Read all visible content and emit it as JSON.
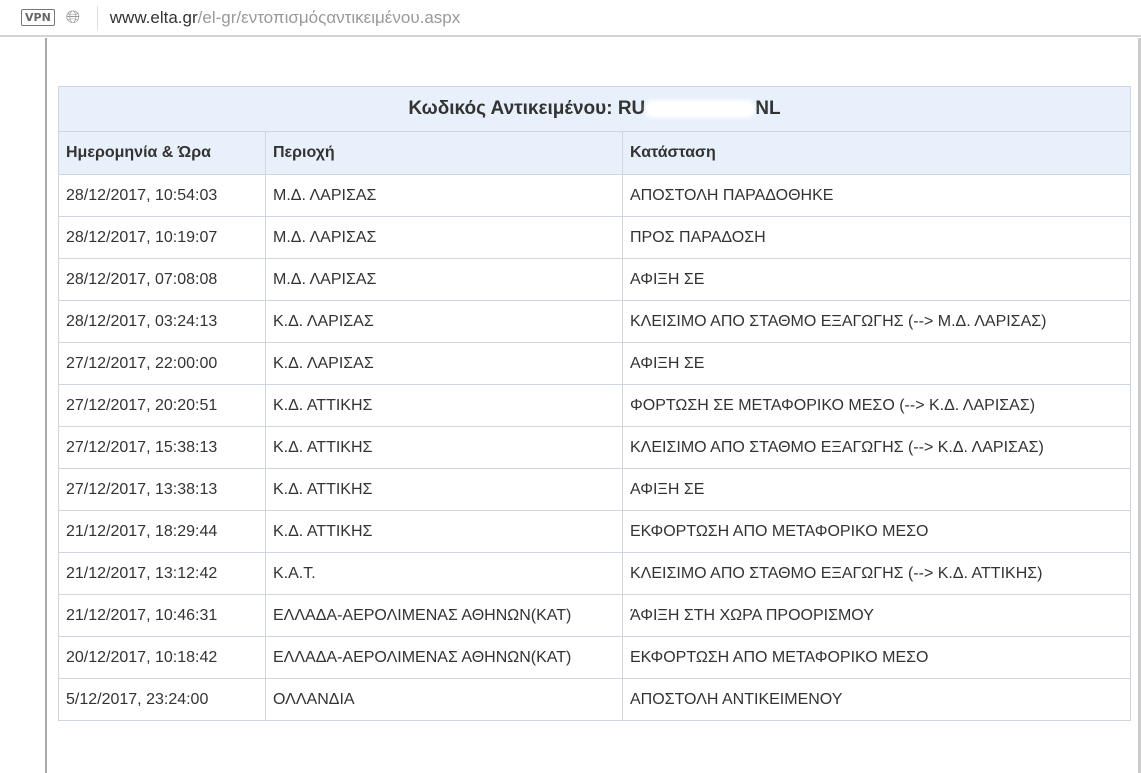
{
  "browser": {
    "vpn_label": "VPN",
    "url_domain": "www.elta.gr",
    "url_path": "/el-gr/εντοπισμόςαντικειμένου.aspx"
  },
  "table": {
    "title_label": "Κωδικός Αντικειμένου:",
    "code_prefix": "RU",
    "code_suffix": "NL",
    "headers": [
      "Ημερομηνία & Ώρα",
      "Περιοχή",
      "Κατάσταση"
    ],
    "rows": [
      [
        "28/12/2017, 10:54:03",
        "Μ.Δ. ΛΑΡΙΣΑΣ",
        "ΑΠΟΣΤΟΛΗ ΠΑΡΑΔΟΘΗΚΕ"
      ],
      [
        "28/12/2017, 10:19:07",
        "Μ.Δ. ΛΑΡΙΣΑΣ",
        "ΠΡΟΣ ΠΑΡΑΔΟΣΗ"
      ],
      [
        "28/12/2017, 07:08:08",
        "Μ.Δ. ΛΑΡΙΣΑΣ",
        "ΑΦΙΞΗ ΣΕ"
      ],
      [
        "28/12/2017, 03:24:13",
        "Κ.Δ. ΛΑΡΙΣΑΣ",
        "ΚΛΕΙΣΙΜΟ ΑΠΟ ΣΤΑΘΜΟ ΕΞΑΓΩΓΗΣ (--> Μ.Δ. ΛΑΡΙΣΑΣ)"
      ],
      [
        "27/12/2017, 22:00:00",
        "Κ.Δ. ΛΑΡΙΣΑΣ",
        "ΑΦΙΞΗ ΣΕ"
      ],
      [
        "27/12/2017, 20:20:51",
        "Κ.Δ. ΑΤΤΙΚΗΣ",
        "ΦΟΡΤΩΣΗ ΣΕ ΜΕΤΑΦΟΡΙΚΟ ΜΕΣΟ (--> Κ.Δ. ΛΑΡΙΣΑΣ)"
      ],
      [
        "27/12/2017, 15:38:13",
        "Κ.Δ. ΑΤΤΙΚΗΣ",
        "ΚΛΕΙΣΙΜΟ ΑΠΟ ΣΤΑΘΜΟ ΕΞΑΓΩΓΗΣ (--> Κ.Δ. ΛΑΡΙΣΑΣ)"
      ],
      [
        "27/12/2017, 13:38:13",
        "Κ.Δ. ΑΤΤΙΚΗΣ",
        "ΑΦΙΞΗ ΣΕ"
      ],
      [
        "21/12/2017, 18:29:44",
        "Κ.Δ. ΑΤΤΙΚΗΣ",
        "ΕΚΦΟΡΤΩΣΗ ΑΠΟ ΜΕΤΑΦΟΡΙΚΟ ΜΕΣΟ"
      ],
      [
        "21/12/2017, 13:12:42",
        "Κ.Α.Τ.",
        "ΚΛΕΙΣΙΜΟ ΑΠΟ ΣΤΑΘΜΟ ΕΞΑΓΩΓΗΣ (--> Κ.Δ. ΑΤΤΙΚΗΣ)"
      ],
      [
        "21/12/2017, 10:46:31",
        "ΕΛΛΑΔΑ-ΑΕΡΟΛΙΜΕΝΑΣ ΑΘΗΝΩΝ(ΚΑΤ)",
        "ΆΦΙΞΗ ΣΤΗ ΧΩΡΑ ΠΡΟΟΡΙΣΜΟΥ"
      ],
      [
        "20/12/2017, 10:18:42",
        "ΕΛΛΑΔΑ-ΑΕΡΟΛΙΜΕΝΑΣ ΑΘΗΝΩΝ(ΚΑΤ)",
        "ΕΚΦΟΡΤΩΣΗ ΑΠΟ ΜΕΤΑΦΟΡΙΚΟ ΜΕΣΟ"
      ],
      [
        "5/12/2017, 23:24:00",
        "ΟΛΛΑΝΔΙΑ",
        "ΑΠΟΣΤΟΛΗ ΑΝΤΙΚΕΙΜΕΝΟΥ"
      ]
    ]
  }
}
